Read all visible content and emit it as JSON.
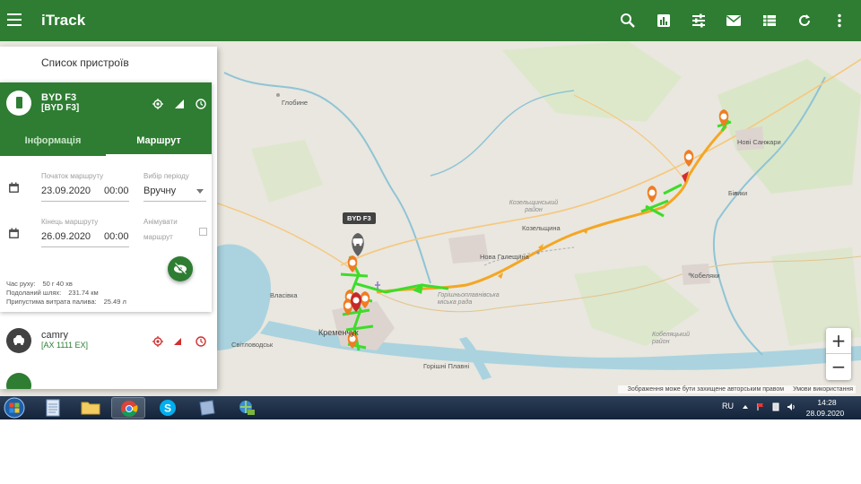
{
  "app": {
    "title": "iTrack"
  },
  "appbar_icons": [
    "search-icon",
    "chart-icon",
    "sliders-icon",
    "mail-icon",
    "table-icon",
    "refresh-icon",
    "more-vert-icon"
  ],
  "colors": {
    "primary": "#2e7d32",
    "route_orange": "#f5a623",
    "route_green": "#3ddc2a",
    "marker_orange": "#ef7d22",
    "marker_red": "#d32f2f"
  },
  "panel": {
    "title": "Список пристроїв",
    "device": {
      "name": "BYD F3",
      "plate": "[BYD F3]",
      "tabs": [
        "Інформація",
        "Маршрут"
      ],
      "active_tab": "Маршрут",
      "route_start_label": "Початок маршруту",
      "route_start_date": "23.09.2020",
      "route_start_time": "00:00",
      "period_label": "Вибір періоду",
      "period_value": "Вручну",
      "route_end_label": "Кінець маршруту",
      "route_end_date": "26.09.2020",
      "route_end_time": "00:00",
      "animate_label_1": "Анімувати",
      "animate_label_2": "маршрут",
      "stats": [
        {
          "label": "Час руху:",
          "value": "50  г   40  хв"
        },
        {
          "label": "Подоланий шлях:",
          "value": "231.74  км"
        },
        {
          "label": "Припустима витрата палива:",
          "value": "25.49  л"
        }
      ]
    },
    "other_devices": [
      {
        "name": "camry",
        "plate": "[AX 1111 EX]"
      }
    ]
  },
  "map": {
    "labels": {
      "vehicle_tag": "BYD F3",
      "globyne": "Глобине",
      "nov_sanzhary": "Нові Санжари",
      "bilyky": "Білики",
      "kozelshchyna_rayon": "Козельщинський район",
      "kozelshchyna": "Козельщина",
      "nova_halesh": "Нова Галещина",
      "vlasivka": "Власівка",
      "kremenchuk": "Кременчук",
      "svitlovodsk": "Світловодськ",
      "horishni_plavni_rayon": "Горішньоплавнівська міська рада",
      "horishni_plavni": "Горішні Плавні",
      "kobeliaky": "Кобеляки",
      "kobeliaky_rayon": "Кобеляцький район"
    },
    "zoom_in": "+",
    "zoom_out": "−",
    "attribution_1": "Зображення може бути захищене авторським правом",
    "attribution_2": "Умови використання"
  },
  "taskbar": {
    "apps": [
      "explorer-icon",
      "folder-icon",
      "chrome-icon",
      "skype-icon",
      "book-icon",
      "network-icon"
    ],
    "lang": "RU",
    "time": "14:28",
    "date": "28.09.2020"
  }
}
